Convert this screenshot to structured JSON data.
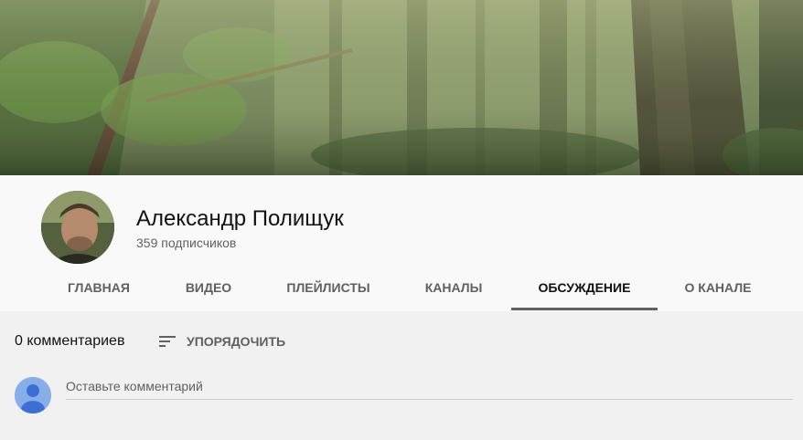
{
  "channel": {
    "name": "Александр Полищук",
    "subscribers": "359 подписчиков"
  },
  "tabs": [
    {
      "label": "ГЛАВНАЯ",
      "active": false
    },
    {
      "label": "ВИДЕО",
      "active": false
    },
    {
      "label": "ПЛЕЙЛИСТЫ",
      "active": false
    },
    {
      "label": "КАНАЛЫ",
      "active": false
    },
    {
      "label": "ОБСУЖДЕНИЕ",
      "active": true
    },
    {
      "label": "О КАНАЛЕ",
      "active": false
    }
  ],
  "discussion": {
    "count_label": "0 комментариев",
    "sort_label": "УПОРЯДОЧИТЬ",
    "comment_placeholder": "Оставьте комментарий"
  },
  "colors": {
    "header_bg": "#f9f9f9",
    "page_bg": "#f1f1f1",
    "tab_active_underline": "#606060",
    "default_avatar": "#88aee9"
  },
  "icons": [
    "sort-icon",
    "default-user-icon"
  ]
}
